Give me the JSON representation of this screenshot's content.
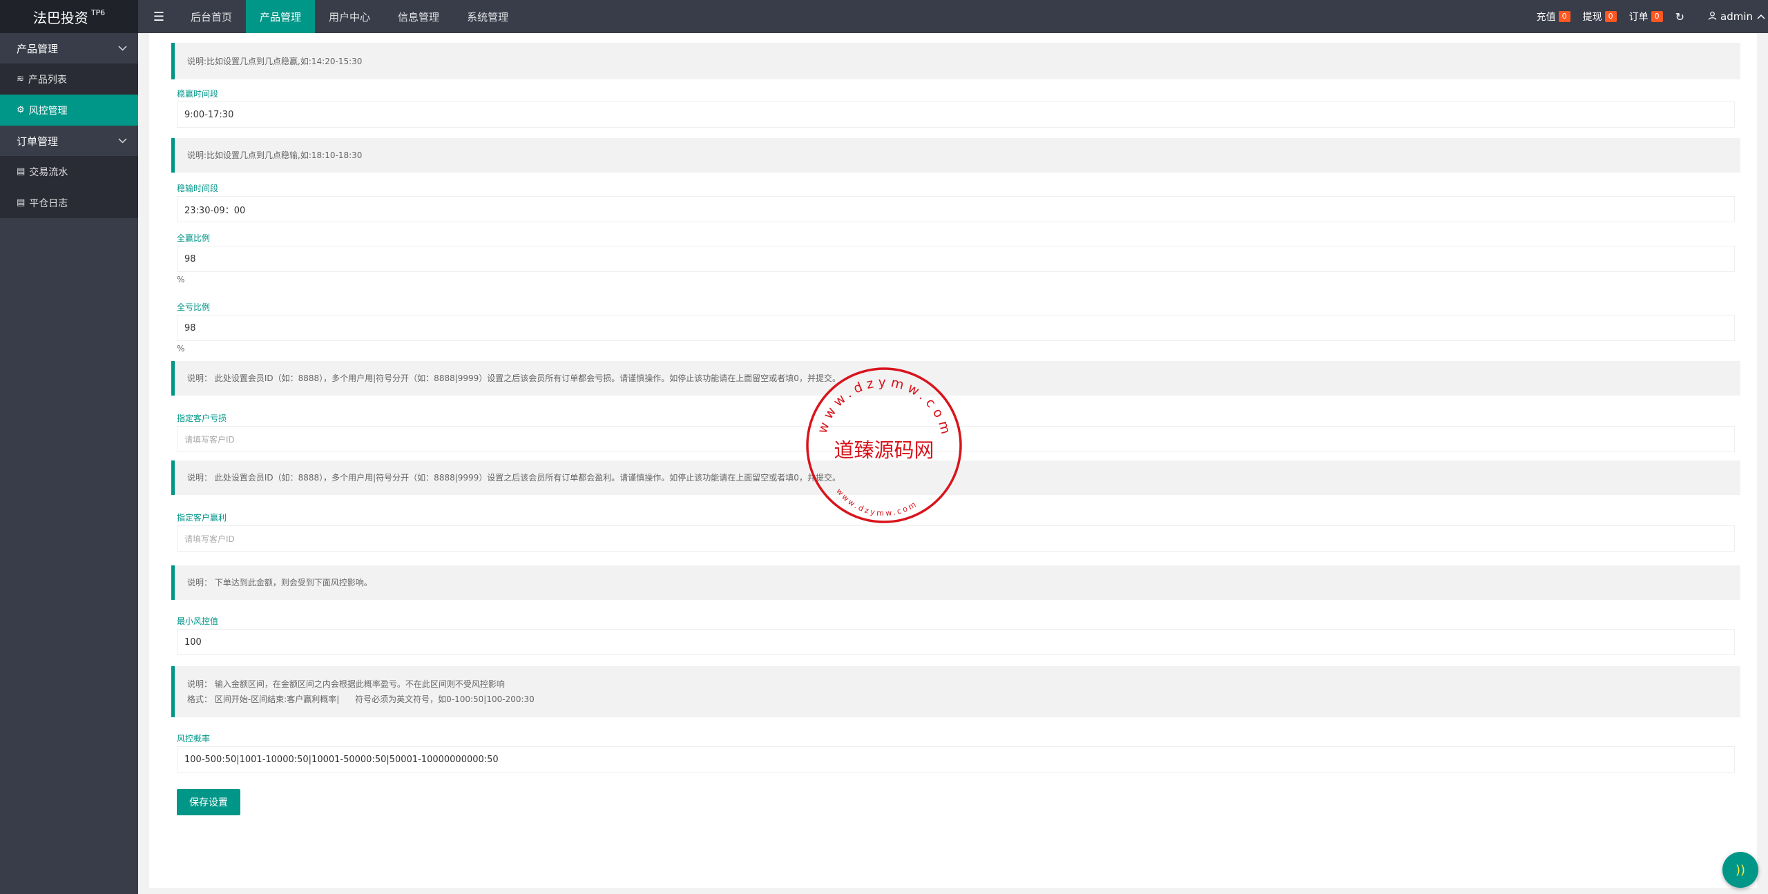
{
  "app": {
    "title": "法巴投资",
    "version": "TP6"
  },
  "header": {
    "menu_icon": "hamburger-icon",
    "nav": [
      {
        "label": "后台首页"
      },
      {
        "label": "产品管理"
      },
      {
        "label": "用户中心"
      },
      {
        "label": "信息管理"
      },
      {
        "label": "系统管理"
      }
    ],
    "recharge": {
      "label": "充值",
      "count": "0"
    },
    "withdraw": {
      "label": "提现",
      "count": "0"
    },
    "orders": {
      "label": "订单",
      "count": "0"
    },
    "user": "admin"
  },
  "sidebar": {
    "groups": [
      {
        "label": "产品管理"
      },
      {
        "label": "订单管理"
      }
    ],
    "items": [
      {
        "label": "产品列表"
      },
      {
        "label": "风控管理"
      },
      {
        "label": "交易流水"
      },
      {
        "label": "平仓日志"
      }
    ]
  },
  "form": {
    "note_win_time": "说明:比如设置几点到几点稳赢,如:14:20-15:30",
    "win_time_label": "稳赢时间段",
    "win_time_value": "9:00-17:30",
    "note_loss_time": "说明:比如设置几点到几点稳输,如:18:10-18:30",
    "loss_time_label": "稳输时间段",
    "loss_time_value": "23:30-09：00",
    "win_ratio_label": "全赢比例",
    "win_ratio_value": "98",
    "win_ratio_unit": "%",
    "loss_ratio_label": "全亏比例",
    "loss_ratio_value": "98",
    "loss_ratio_unit": "%",
    "note_loss_user": "说明： 此处设置会员ID（如：8888），多个用户用|符号分开（如：8888|9999）设置之后该会员所有订单都会亏损。请谨慎操作。如停止该功能请在上面留空或者填0，并提交。",
    "loss_user_label": "指定客户亏损",
    "loss_user_placeholder": "请填写客户ID",
    "note_win_user": "说明： 此处设置会员ID（如：8888），多个用户用|符号分开（如：8888|9999）设置之后该会员所有订单都会盈利。请谨慎操作。如停止该功能请在上面留空或者填0，并提交。",
    "win_user_label": "指定客户赢利",
    "win_user_placeholder": "请填写客户ID",
    "note_min": "说明： 下单达到此金额，则会受到下面风控影响。",
    "min_label": "最小风控值",
    "min_value": "100",
    "note_prob_line1": "说明： 输入金额区间，在金额区间之内会根据此概率盈亏。不在此区间则不受风控影响",
    "note_prob_line2": "格式： 区间开始-区间结束:客户赢利概率|      符号必须为英文符号，如0-100:50|100-200:30",
    "prob_label": "风控概率",
    "prob_value": "100-500:50|1001-10000:50|10001-50000:50|50001-10000000000:50",
    "save_label": "保存设置"
  },
  "stamp": {
    "center_text": "道臻源码网",
    "ring_top": "www.dzymw.com",
    "ring_bottom": "www.dzymw.com",
    "color": "#d9141c"
  }
}
